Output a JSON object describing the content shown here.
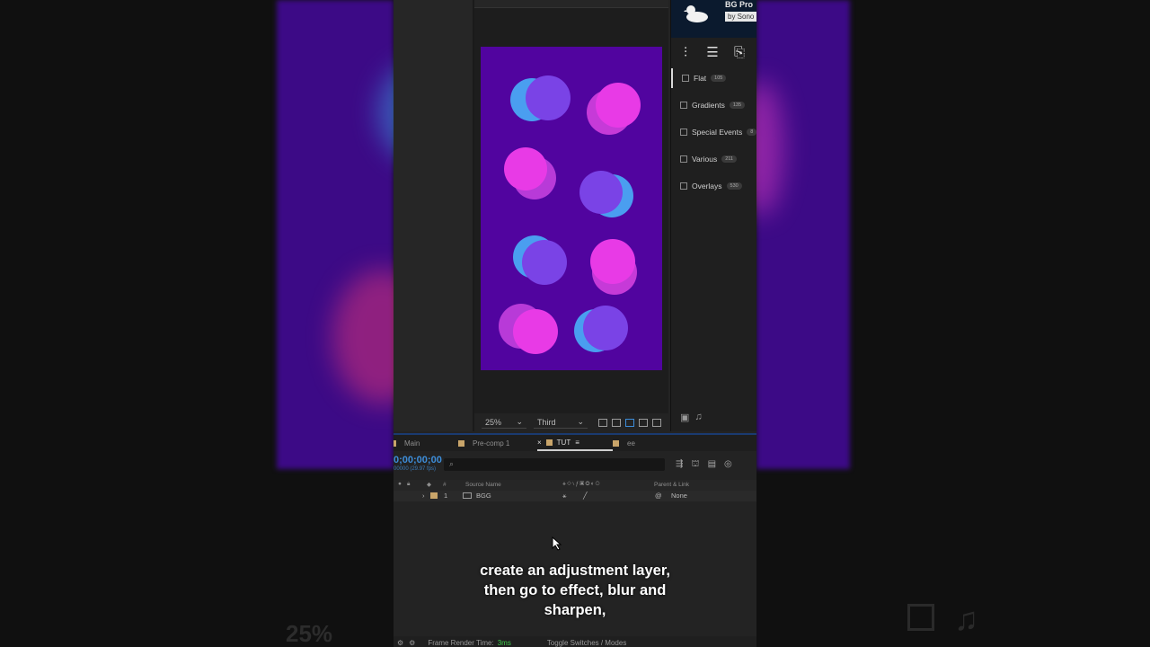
{
  "viewer": {
    "zoom": "25%",
    "view_mode": "Third"
  },
  "plugin": {
    "title": "BG Pro",
    "by": "by Sono",
    "categories": [
      {
        "label": "Flat",
        "count": "105"
      },
      {
        "label": "Gradients",
        "count": "135"
      },
      {
        "label": "Special Events",
        "count": "8"
      },
      {
        "label": "Various",
        "count": "211"
      },
      {
        "label": "Overlays",
        "count": "530"
      }
    ]
  },
  "timeline": {
    "tabs": [
      "Main",
      "Pre-comp 1",
      "TUT",
      "ee"
    ],
    "timecode": "0;00;00;00",
    "fps": "00000 (29.97 fps)",
    "columns": {
      "index": "#",
      "source": "Source Name",
      "parent": "Parent & Link"
    },
    "layers": [
      {
        "index": "1",
        "name": "BGG",
        "parent": "None"
      }
    ]
  },
  "subtitle": [
    "create an adjustment layer,",
    "then go to effect, blur and",
    "sharpen,"
  ],
  "status": {
    "label": "Frame Render Time:",
    "value": "3ms",
    "toggle": "Toggle Switches / Modes"
  },
  "colors": {
    "canvas_bg": "#51049f",
    "dot_pink": "#e83ae6",
    "dot_violet": "#7a43e6",
    "dot_blue": "#4a9ef0",
    "accent_blue": "#3d8dd9"
  }
}
